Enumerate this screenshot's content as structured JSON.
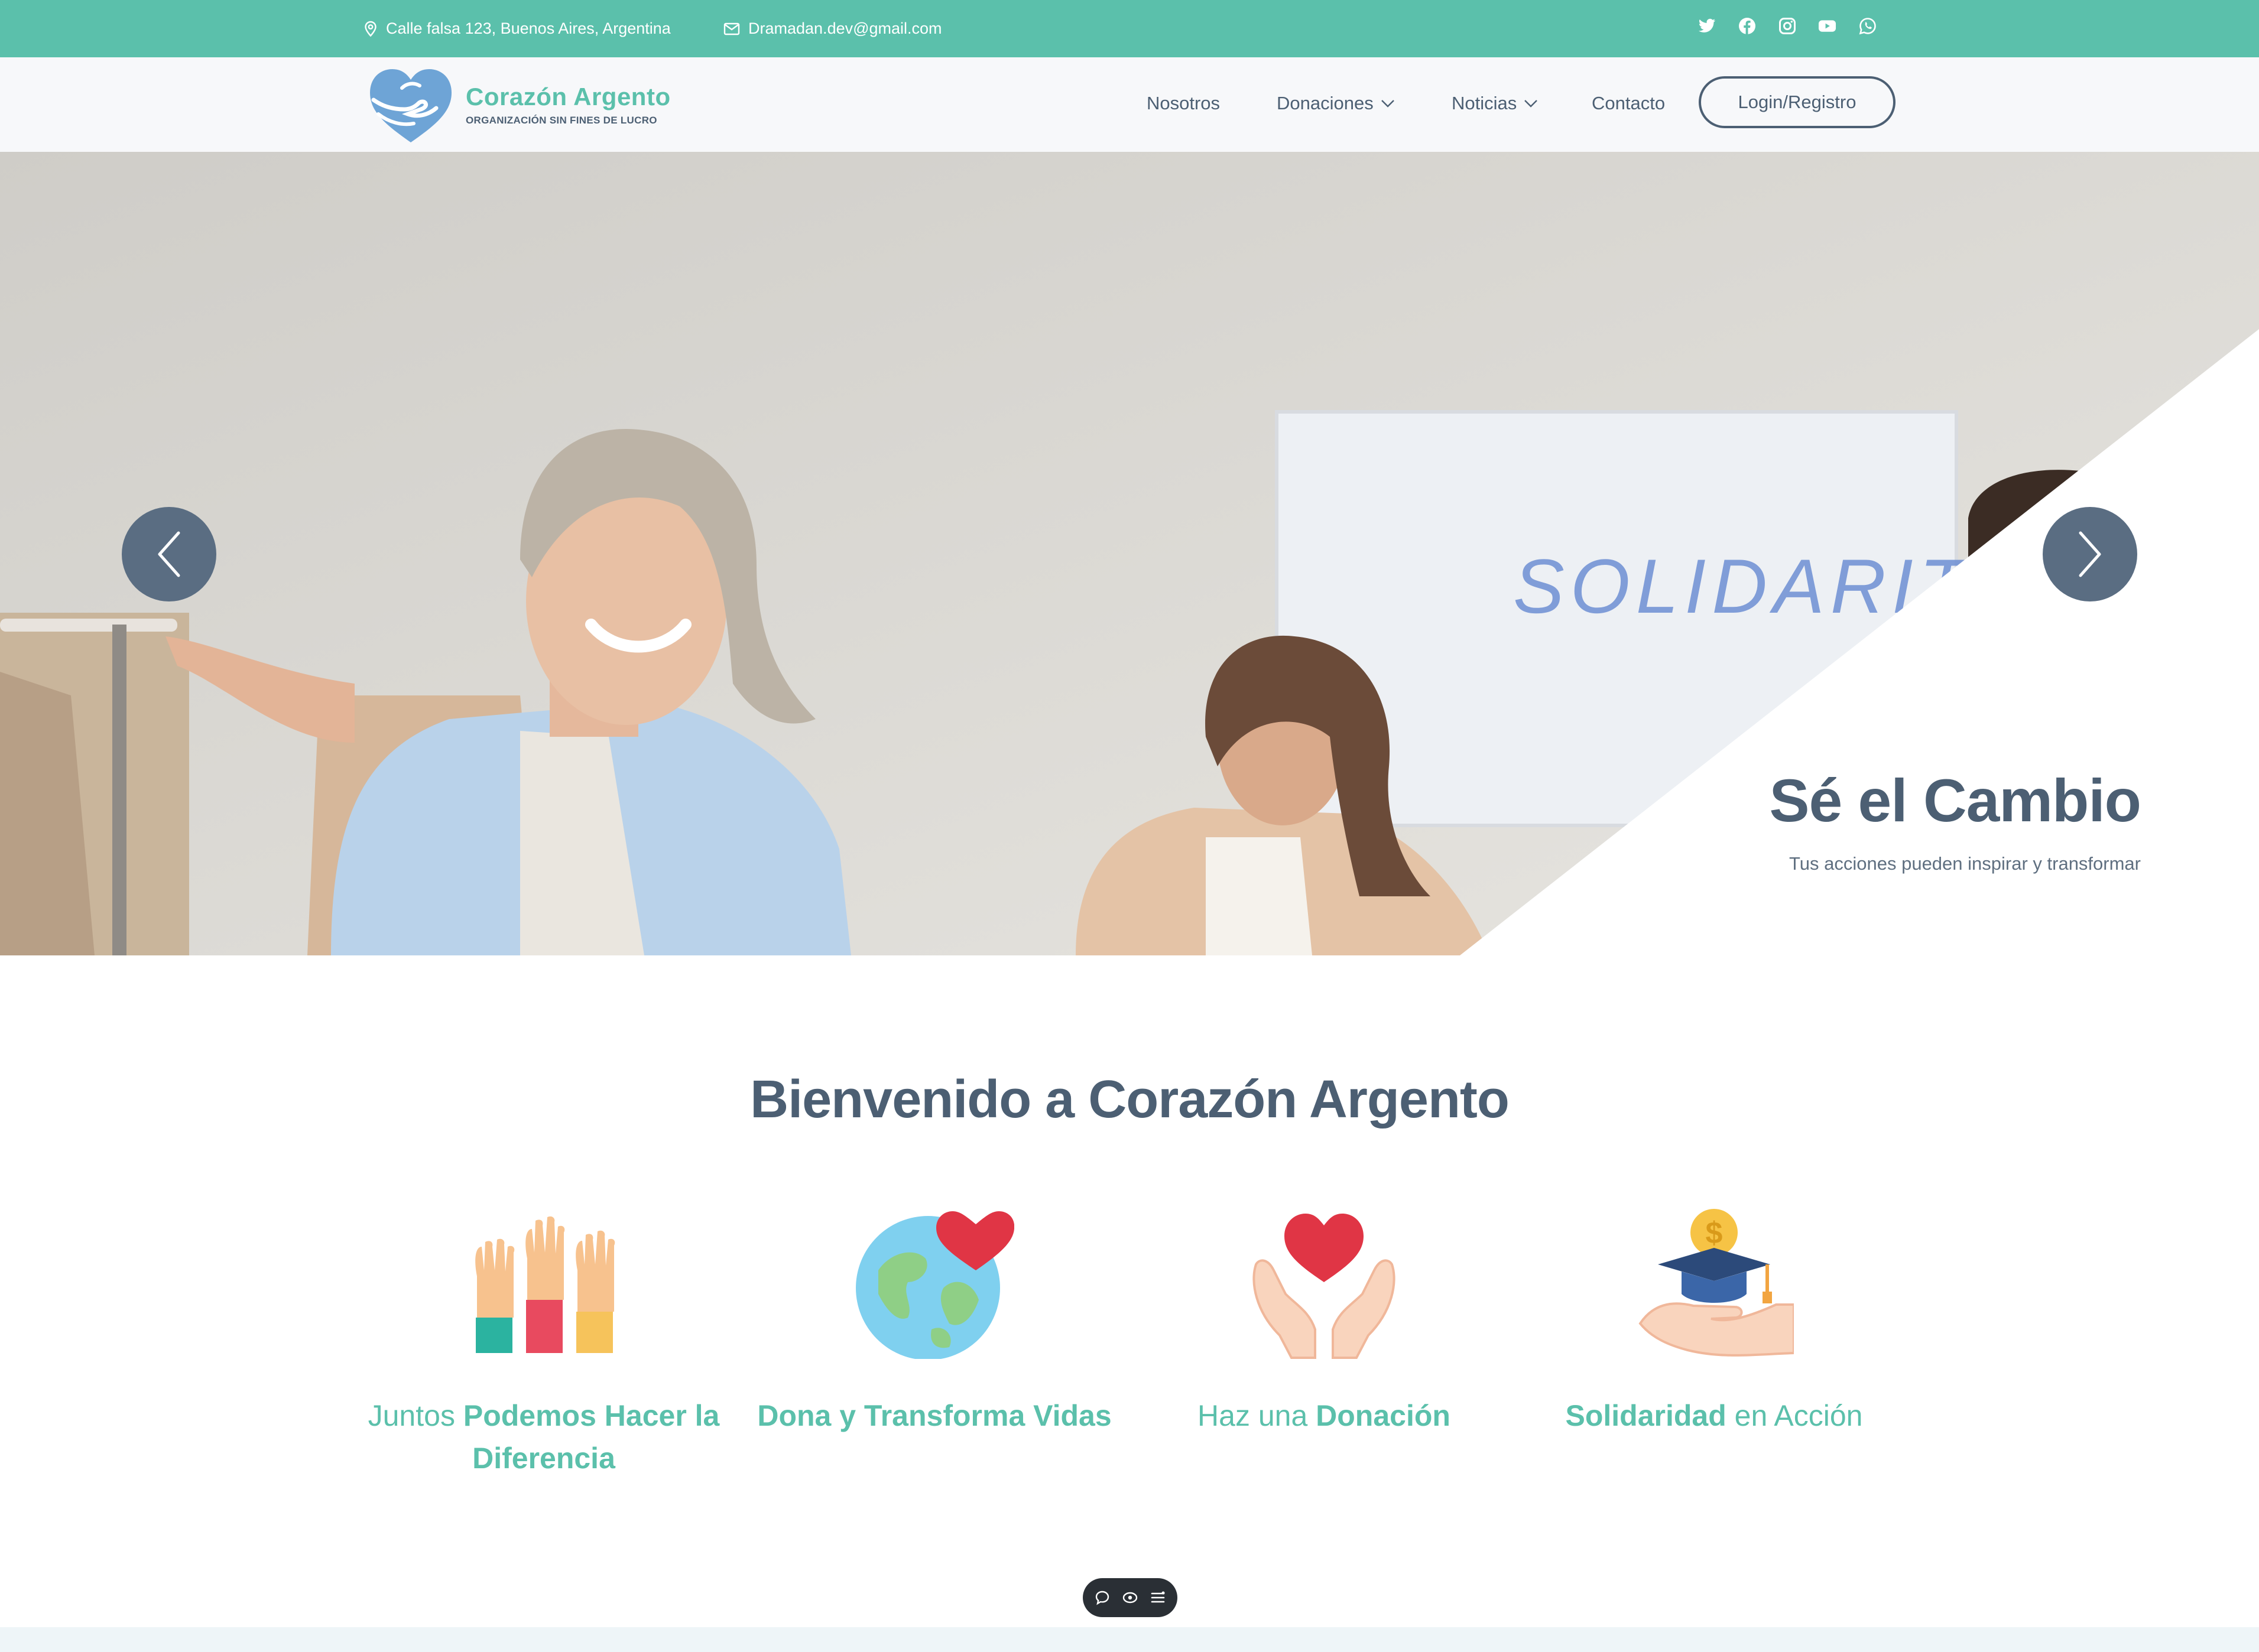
{
  "topbar": {
    "address": "Calle falsa 123, Buenos Aires, Argentina",
    "email": "Dramadan.dev@gmail.com",
    "social": [
      "twitter-icon",
      "facebook-icon",
      "instagram-icon",
      "youtube-icon",
      "whatsapp-icon"
    ]
  },
  "brand": {
    "name": "Corazón Argento",
    "tagline": "ORGANIZACIÓN SIN FINES DE LUCRO"
  },
  "nav": {
    "items": [
      {
        "label": "Nosotros",
        "dropdown": false
      },
      {
        "label": "Donaciones",
        "dropdown": true
      },
      {
        "label": "Noticias",
        "dropdown": true
      },
      {
        "label": "Contacto",
        "dropdown": false
      }
    ],
    "login_label": "Login/Registro"
  },
  "hero": {
    "title": "Sé el Cambio",
    "subtitle": "Tus acciones pueden inspirar y transformar",
    "board_text": "SOLIDARITY"
  },
  "welcome": {
    "title": "Bienvenido a Corazón Argento"
  },
  "features": [
    {
      "pre": "Juntos ",
      "bold": "Podemos Hacer la Diferencia",
      "post": "",
      "icon": "raised-hands-icon"
    },
    {
      "pre": "",
      "bold": "Dona y Transforma Vidas",
      "post": "",
      "icon": "globe-heart-icon"
    },
    {
      "pre": "Haz una ",
      "bold": "Donación",
      "post": "",
      "icon": "hands-heart-icon"
    },
    {
      "pre": "",
      "bold": "Solidaridad",
      "post": " en Acción",
      "icon": "graduation-hand-icon"
    }
  ],
  "colors": {
    "accent": "#5bc0ab",
    "text": "#4c5f73",
    "nav_bg": "#f7f8fa",
    "arrow_bg": "#5a6d82"
  }
}
